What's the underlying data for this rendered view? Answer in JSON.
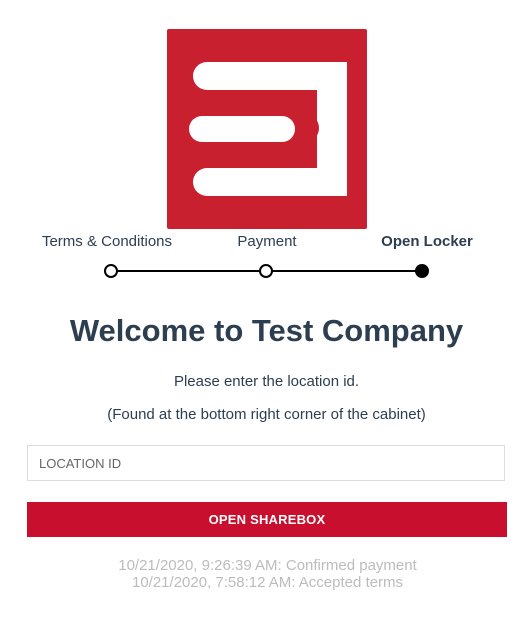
{
  "logo": {
    "icon": "brand-logo-icon",
    "background": "#c8202f",
    "foreground": "#ffffff"
  },
  "steps": [
    {
      "label": "Terms & Conditions",
      "active": false
    },
    {
      "label": "Payment",
      "active": false
    },
    {
      "label": "Open Locker",
      "active": true
    }
  ],
  "welcome": {
    "title": "Welcome to Test Company",
    "instruction": "Please enter the location id.",
    "hint": "(Found at the bottom right corner of the cabinet)"
  },
  "form": {
    "location_placeholder": "LOCATION ID",
    "location_value": "",
    "submit_label": "OPEN SHAREBOX"
  },
  "log": [
    "10/21/2020, 9:26:39 AM: Confirmed payment",
    "10/21/2020, 7:58:12 AM: Accepted terms"
  ],
  "colors": {
    "accent": "#c8102e",
    "text": "#2c3e50",
    "muted": "#bcbcbc"
  }
}
